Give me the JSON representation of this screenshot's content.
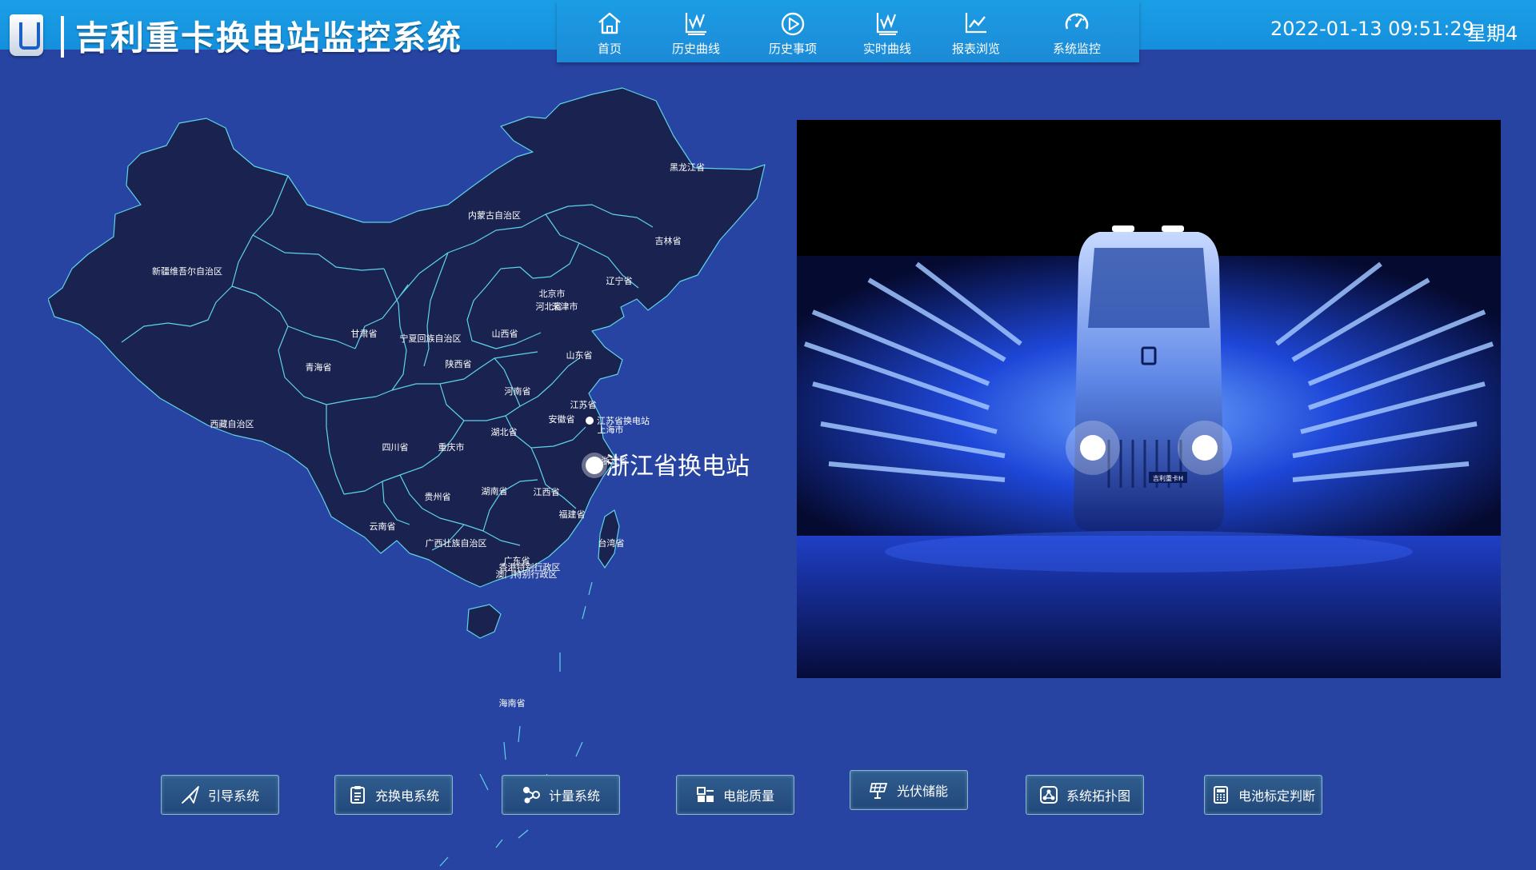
{
  "header": {
    "title": "吉利重卡换电站监控系统",
    "datetime": "2022-01-13 09:51:29",
    "weekday": "星期4",
    "colors": {
      "bar": "#1a9fe6",
      "background": "#2744a3"
    }
  },
  "nav": {
    "items": [
      {
        "label": "首页",
        "icon": "home-icon"
      },
      {
        "label": "历史曲线",
        "icon": "history-curve-icon"
      },
      {
        "label": "历史事项",
        "icon": "play-circle-icon"
      },
      {
        "label": "实时曲线",
        "icon": "realtime-curve-icon"
      },
      {
        "label": "报表浏览",
        "icon": "line-chart-icon"
      },
      {
        "label": "系统监控",
        "icon": "gauge-icon"
      }
    ]
  },
  "map": {
    "provinces": [
      "黑龙江省",
      "吉林省",
      "辽宁省",
      "内蒙古自治区",
      "新疆维吾尔自治区",
      "北京市",
      "河北省",
      "天津市",
      "甘肃省",
      "宁夏回族自治区",
      "山西省",
      "山东省",
      "青海省",
      "陕西省",
      "河南省",
      "江苏省",
      "西藏自治区",
      "安徽省",
      "上海市",
      "湖北省",
      "四川省",
      "重庆市",
      "浙江省",
      "湖南省",
      "江西省",
      "贵州省",
      "福建省",
      "云南省",
      "台湾省",
      "广西壮族自治区",
      "广东省",
      "香港特别行政区",
      "澳门特别行政区",
      "海南省"
    ],
    "stations": [
      {
        "name": "浙江省换电站",
        "highlighted": true
      },
      {
        "name": "江苏省换电站",
        "highlighted": false
      }
    ],
    "colors": {
      "land": "#1a2350",
      "border": "#5fd3e8"
    }
  },
  "photo": {
    "badge": "吉利重卡H"
  },
  "buttons": [
    {
      "label": "引导系统",
      "icon": "paper-plane-icon"
    },
    {
      "label": "充换电系统",
      "icon": "clipboard-icon"
    },
    {
      "label": "计量系统",
      "icon": "meter-icon"
    },
    {
      "label": "电能质量",
      "icon": "power-quality-icon"
    },
    {
      "label": "光伏储能",
      "icon": "solar-panel-icon"
    },
    {
      "label": "系统拓扑图",
      "icon": "topology-icon"
    },
    {
      "label": "电池标定判断",
      "icon": "calculator-icon"
    }
  ]
}
